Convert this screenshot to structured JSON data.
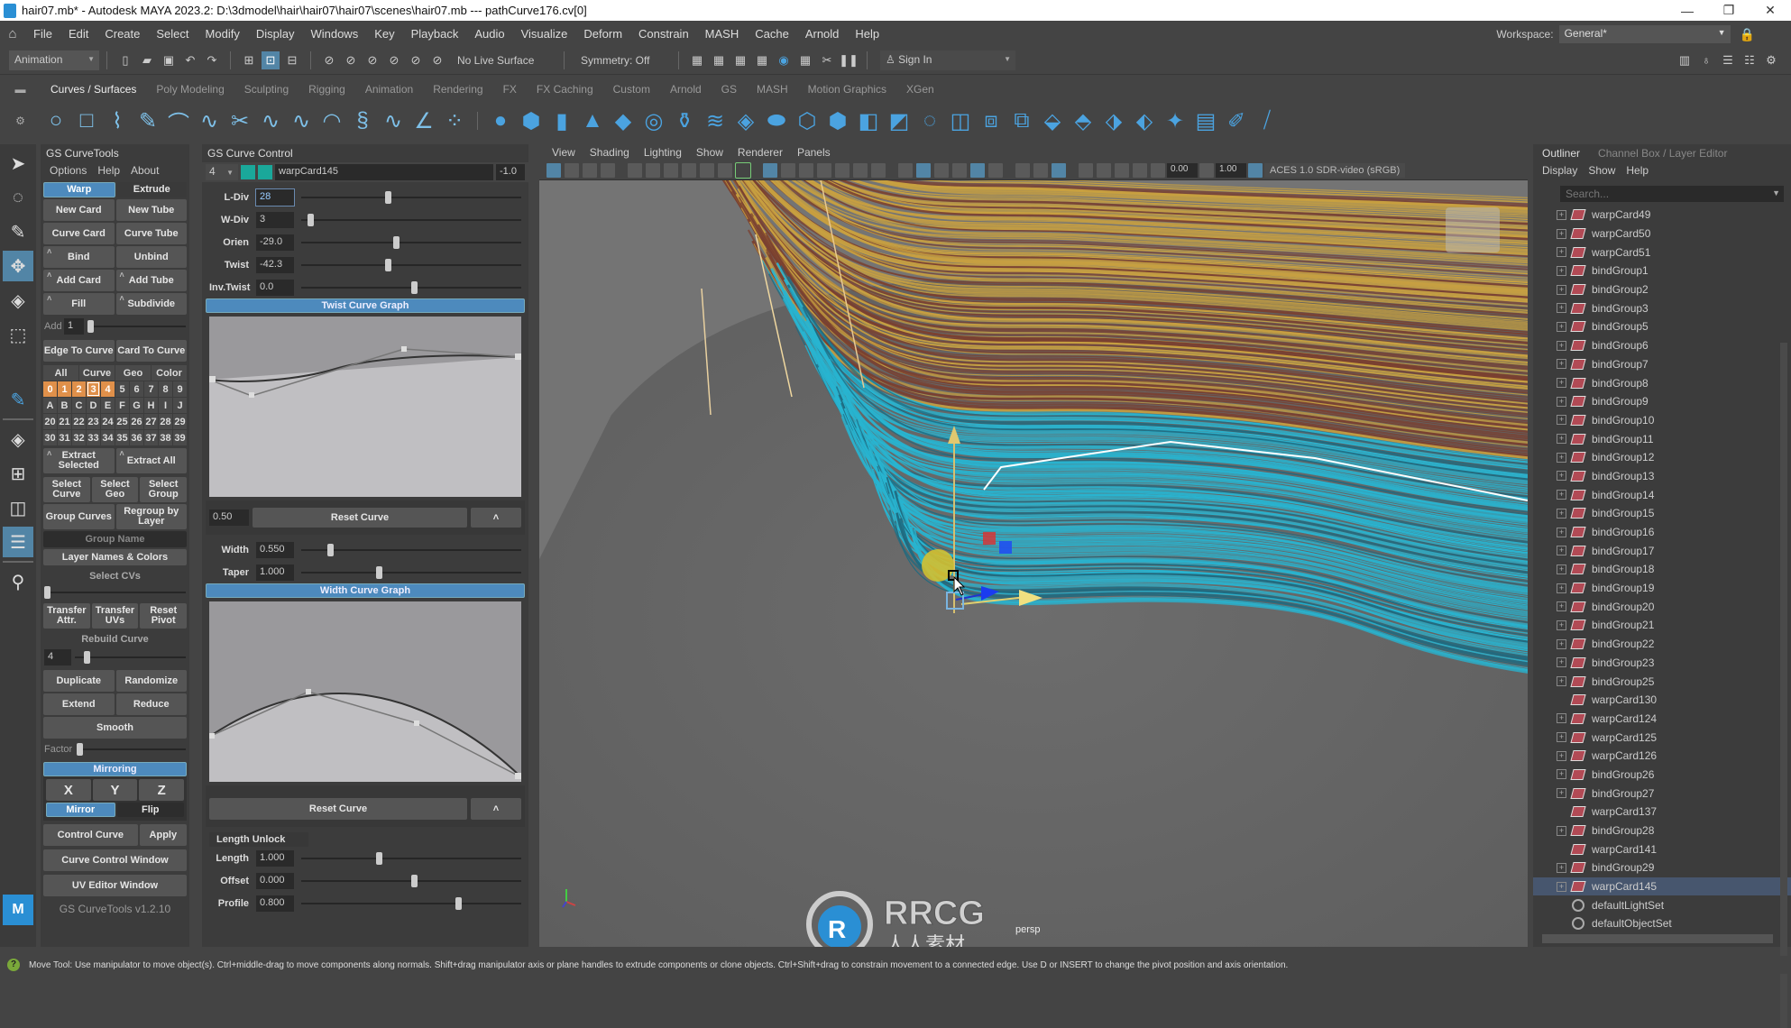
{
  "window": {
    "title": "hair07.mb* - Autodesk MAYA 2023.2: D:\\3dmodel\\hair\\hair07\\hair07\\scenes\\hair07.mb   ---   pathCurve176.cv[0]",
    "controls": [
      "—",
      "❐",
      "✕"
    ]
  },
  "menubar": {
    "items": [
      "File",
      "Edit",
      "Create",
      "Select",
      "Modify",
      "Display",
      "Windows",
      "Key",
      "Playback",
      "Audio",
      "Visualize",
      "Deform",
      "Constrain",
      "MASH",
      "Cache",
      "Arnold",
      "Help"
    ],
    "workspace_label": "Workspace:",
    "workspace_value": "General*"
  },
  "statusline": {
    "menuset": "Animation",
    "live_surface": "No Live Surface",
    "symmetry": "Symmetry: Off",
    "sign_in": "Sign In"
  },
  "shelf": {
    "tabs": [
      "Curves / Surfaces",
      "Poly Modeling",
      "Sculpting",
      "Rigging",
      "Animation",
      "Rendering",
      "FX",
      "FX Caching",
      "Custom",
      "Arnold",
      "GS",
      "MASH",
      "Motion Graphics",
      "XGen"
    ],
    "active_tab": "Curves / Surfaces"
  },
  "gs_curvetools": {
    "title": "GS CurveTools",
    "menu": [
      "Options",
      "Help",
      "About"
    ],
    "mode": {
      "warp": "Warp",
      "extrude": "Extrude",
      "active": "Warp"
    },
    "buttons": {
      "new_card": "New Card",
      "new_tube": "New Tube",
      "curve_card": "Curve Card",
      "curve_tube": "Curve Tube",
      "bind": "Bind",
      "unbind": "Unbind",
      "add_card": "Add Card",
      "add_tube": "Add Tube",
      "fill": "Fill",
      "subdivide": "Subdivide",
      "add_label": "Add",
      "add_value": "1",
      "edge_to_curve": "Edge To Curve",
      "card_to_curve": "Card To Curve"
    },
    "layer_filter": [
      "All",
      "Curve",
      "Geo",
      "Color"
    ],
    "layers": [
      [
        "0",
        "1",
        "2",
        "3",
        "4",
        "5",
        "6",
        "7",
        "8",
        "9"
      ],
      [
        "A",
        "B",
        "C",
        "D",
        "E",
        "F",
        "G",
        "H",
        "I",
        "J"
      ],
      [
        "20",
        "21",
        "22",
        "23",
        "24",
        "25",
        "26",
        "27",
        "28",
        "29"
      ],
      [
        "30",
        "31",
        "32",
        "33",
        "34",
        "35",
        "36",
        "37",
        "38",
        "39"
      ]
    ],
    "selected_layers": [
      "0",
      "1",
      "2",
      "3",
      "4"
    ],
    "current_layer": "3",
    "buttons2": {
      "extract_selected": "Extract Selected",
      "extract_all": "Extract All",
      "select_curve": "Select Curve",
      "select_geo": "Select Geo",
      "select_group": "Select Group",
      "group_curves": "Group Curves",
      "regroup_by_layer": "Regroup by Layer",
      "group_name": "Group Name",
      "layer_names_colors": "Layer Names & Colors",
      "select_cvs": "Select CVs",
      "transfer_attr": "Transfer Attr.",
      "transfer_uvs": "Transfer UVs",
      "reset_pivot": "Reset Pivot",
      "rebuild_curve": "Rebuild Curve",
      "rebuild_value": "4",
      "duplicate": "Duplicate",
      "randomize": "Randomize",
      "extend": "Extend",
      "reduce": "Reduce",
      "smooth": "Smooth",
      "factor": "Factor",
      "mirroring": "Mirroring",
      "x": "X",
      "y": "Y",
      "z": "Z",
      "mirror": "Mirror",
      "flip": "Flip",
      "control_curve": "Control Curve",
      "apply": "Apply",
      "curve_control_window": "Curve Control Window",
      "uv_editor_window": "UV Editor Window"
    },
    "version": "GS CurveTools v1.2.10"
  },
  "curve_control": {
    "title": "GS Curve Control",
    "layer_num": "4",
    "object_name": "warpCard145",
    "object_value": "-1.0",
    "sliders": [
      {
        "label": "L-Div",
        "value": "28",
        "pos": 0.38
      },
      {
        "label": "W-Div",
        "value": "3",
        "pos": 0.03
      },
      {
        "label": "Orien",
        "value": "-29.0",
        "pos": 0.42
      },
      {
        "label": "Twist",
        "value": "-42.3",
        "pos": 0.38
      },
      {
        "label": "Inv.Twist",
        "value": "0.0",
        "pos": 0.5
      }
    ],
    "twist_graph_title": "Twist Curve Graph",
    "twist_graph_value": "0.50",
    "reset_curve": "Reset Curve",
    "caret": "˄",
    "sliders2": [
      {
        "label": "Width",
        "value": "0.550",
        "pos": 0.12
      },
      {
        "label": "Taper",
        "value": "1.000",
        "pos": 0.34
      }
    ],
    "width_graph_title": "Width Curve Graph",
    "length_unlock": "Length Unlock",
    "sliders3": [
      {
        "label": "Length",
        "value": "1.000",
        "pos": 0.34
      },
      {
        "label": "Offset",
        "value": "0.000",
        "pos": 0.5
      },
      {
        "label": "Profile",
        "value": "0.800",
        "pos": 0.7
      }
    ]
  },
  "viewport": {
    "menu": [
      "View",
      "Shading",
      "Lighting",
      "Show",
      "Renderer",
      "Panels"
    ],
    "exposure": "0.00",
    "gamma": "1.00",
    "color_space": "ACES 1.0 SDR-video (sRGB)",
    "camera": "persp",
    "watermark_brand": "RRCG",
    "watermark_sub": "人人素材"
  },
  "outliner": {
    "tabs": [
      "Outliner",
      "Channel Box / Layer Editor"
    ],
    "menu": [
      "Display",
      "Show",
      "Help"
    ],
    "search_placeholder": "Search...",
    "items": [
      {
        "name": "warpCard49",
        "exp": true
      },
      {
        "name": "warpCard50",
        "exp": true
      },
      {
        "name": "warpCard51",
        "exp": true
      },
      {
        "name": "bindGroup1",
        "exp": true
      },
      {
        "name": "bindGroup2",
        "exp": true
      },
      {
        "name": "bindGroup3",
        "exp": true
      },
      {
        "name": "bindGroup5",
        "exp": true
      },
      {
        "name": "bindGroup6",
        "exp": true
      },
      {
        "name": "bindGroup7",
        "exp": true
      },
      {
        "name": "bindGroup8",
        "exp": true
      },
      {
        "name": "bindGroup9",
        "exp": true
      },
      {
        "name": "bindGroup10",
        "exp": true
      },
      {
        "name": "bindGroup11",
        "exp": true
      },
      {
        "name": "bindGroup12",
        "exp": true
      },
      {
        "name": "bindGroup13",
        "exp": true
      },
      {
        "name": "bindGroup14",
        "exp": true
      },
      {
        "name": "bindGroup15",
        "exp": true
      },
      {
        "name": "bindGroup16",
        "exp": true
      },
      {
        "name": "bindGroup17",
        "exp": true
      },
      {
        "name": "bindGroup18",
        "exp": true
      },
      {
        "name": "bindGroup19",
        "exp": true
      },
      {
        "name": "bindGroup20",
        "exp": true
      },
      {
        "name": "bindGroup21",
        "exp": true
      },
      {
        "name": "bindGroup22",
        "exp": true
      },
      {
        "name": "bindGroup23",
        "exp": true
      },
      {
        "name": "bindGroup25",
        "exp": true
      },
      {
        "name": "warpCard130",
        "exp": false
      },
      {
        "name": "warpCard124",
        "exp": true
      },
      {
        "name": "warpCard125",
        "exp": true
      },
      {
        "name": "warpCard126",
        "exp": true
      },
      {
        "name": "bindGroup26",
        "exp": true
      },
      {
        "name": "bindGroup27",
        "exp": true
      },
      {
        "name": "warpCard137",
        "exp": false
      },
      {
        "name": "bindGroup28",
        "exp": true
      },
      {
        "name": "warpCard141",
        "exp": false
      },
      {
        "name": "bindGroup29",
        "exp": true
      },
      {
        "name": "warpCard145",
        "exp": true,
        "selected": true
      },
      {
        "name": "defaultLightSet",
        "exp": false,
        "set": true
      },
      {
        "name": "defaultObjectSet",
        "exp": false,
        "set": true
      }
    ]
  },
  "helpline": {
    "text": "Move Tool: Use manipulator to move object(s). Ctrl+middle-drag to move components along normals. Shift+drag manipulator axis or plane handles to extrude components or clone objects. Ctrl+Shift+drag to constrain movement to a connected edge. Use D or INSERT to change the pivot position and axis orientation."
  },
  "colors": {
    "accent": "#4d8abd",
    "layer_selected": "#e0904a",
    "hair_cyan": "#28b4d0",
    "hair_gold": "#c8a040",
    "hair_brown": "#7a4030"
  }
}
